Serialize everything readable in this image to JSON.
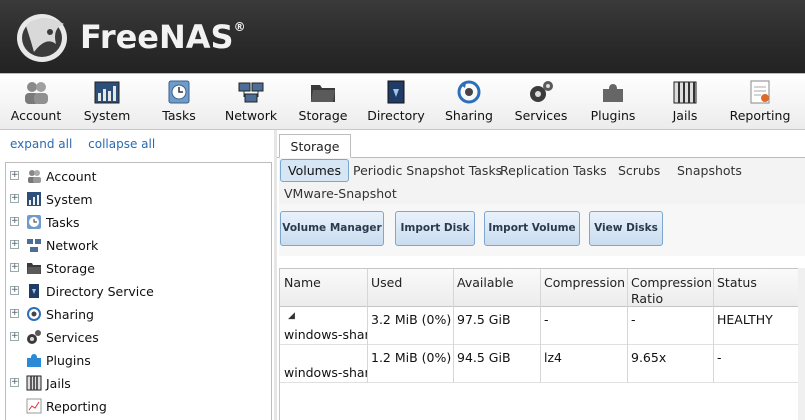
{
  "app": {
    "logo_text": "FreeNAS",
    "logo_mark": "®"
  },
  "topnav": [
    {
      "label": "Account",
      "icon": "users-icon"
    },
    {
      "label": "System",
      "icon": "system-icon"
    },
    {
      "label": "Tasks",
      "icon": "clock-icon"
    },
    {
      "label": "Network",
      "icon": "network-icon"
    },
    {
      "label": "Storage",
      "icon": "folder-icon"
    },
    {
      "label": "Directory",
      "icon": "directory-icon"
    },
    {
      "label": "Sharing",
      "icon": "sharing-icon"
    },
    {
      "label": "Services",
      "icon": "gears-icon"
    },
    {
      "label": "Plugins",
      "icon": "puzzle-icon"
    },
    {
      "label": "Jails",
      "icon": "jails-icon"
    },
    {
      "label": "Reporting",
      "icon": "report-icon"
    }
  ],
  "sidebar": {
    "expand_all": "expand all",
    "collapse_all": "collapse all",
    "items": [
      {
        "label": "Account",
        "expandable": true
      },
      {
        "label": "System",
        "expandable": true
      },
      {
        "label": "Tasks",
        "expandable": true
      },
      {
        "label": "Network",
        "expandable": true
      },
      {
        "label": "Storage",
        "expandable": true
      },
      {
        "label": "Directory Service",
        "expandable": true
      },
      {
        "label": "Sharing",
        "expandable": true
      },
      {
        "label": "Services",
        "expandable": true
      },
      {
        "label": "Plugins",
        "expandable": false
      },
      {
        "label": "Jails",
        "expandable": true
      },
      {
        "label": "Reporting",
        "expandable": false
      }
    ]
  },
  "main": {
    "tab": "Storage",
    "subtabs": [
      "Volumes",
      "Periodic Snapshot Tasks",
      "Replication Tasks",
      "Scrubs",
      "Snapshots",
      "VMware-Snapshot"
    ],
    "actions": [
      "Volume Manager",
      "Import Disk",
      "Import Volume",
      "View Disks"
    ],
    "table": {
      "columns": [
        "Name",
        "Used",
        "Available",
        "Compression",
        "Compression Ratio",
        "Status"
      ],
      "rows": [
        {
          "name": "windows-share",
          "used": "3.2 MiB (0%)",
          "available": "97.5 GiB",
          "compression": "-",
          "ratio": "-",
          "status": "HEALTHY"
        },
        {
          "name": "windows-share",
          "used": "1.2 MiB (0%)",
          "available": "94.5 GiB",
          "compression": "lz4",
          "ratio": "9.65x",
          "status": "-"
        }
      ]
    }
  },
  "colors": {
    "header_bg": "#2a2a2a",
    "link": "#2a6bb0",
    "button_border": "#7fa6cc",
    "active_subtab": "#d6e6f5"
  }
}
